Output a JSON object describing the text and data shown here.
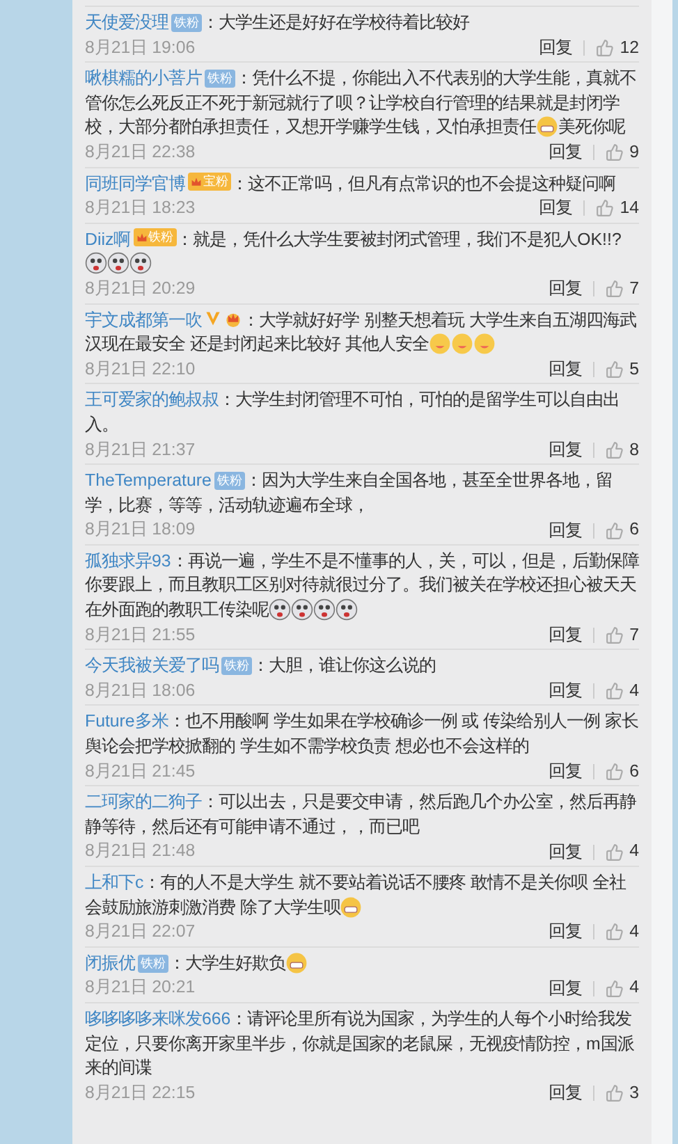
{
  "comments": [
    {
      "user": "天使爱没理",
      "badges": [
        {
          "kind": "fan",
          "text": "铁粉"
        }
      ],
      "content": [
        {
          "kind": "text",
          "text": "：大学生还是好好在学校待着比较好"
        }
      ],
      "time": "8月21日 19:06",
      "reply": "回复",
      "likes": "12"
    },
    {
      "user": "啾棋糯的小菩片",
      "badges": [
        {
          "kind": "fan",
          "text": "铁粉"
        }
      ],
      "content": [
        {
          "kind": "text",
          "text": "：凭什么不提，你能出入不代表别的大学生能，真就不管你怎么死反正不死于新冠就行了呗？让学校自行管理的结果就是封闭学校，大部分都怕承担责任，又想开学赚学生钱，又怕承担责任"
        },
        {
          "kind": "grin"
        },
        {
          "kind": "text",
          "text": "美死你呢"
        }
      ],
      "time": "8月21日 22:38",
      "reply": "回复",
      "likes": "9"
    },
    {
      "user": "同班同学官博",
      "badges": [
        {
          "kind": "gold",
          "text": "宝粉"
        }
      ],
      "content": [
        {
          "kind": "text",
          "text": "：这不正常吗，但凡有点常识的也不会提这种疑问啊"
        }
      ],
      "time": "8月21日 18:23",
      "reply": "回复",
      "likes": "14"
    },
    {
      "user": "Diiz啊",
      "badges": [
        {
          "kind": "gold",
          "text": "铁粉"
        }
      ],
      "content": [
        {
          "kind": "text",
          "text": "：就是，凭什么大学生要被封闭式管理，我们不是犯人OK!!?"
        },
        {
          "kind": "cry"
        },
        {
          "kind": "cry"
        },
        {
          "kind": "cry"
        }
      ],
      "time": "8月21日 20:29",
      "reply": "回复",
      "likes": "7"
    },
    {
      "user": "宇文成都第一吹",
      "badges": [
        {
          "kind": "vip"
        },
        {
          "kind": "crown"
        }
      ],
      "content": [
        {
          "kind": "text",
          "text": "：大学就好好学  别整天想着玩 大学生来自五湖四海武汉现在最安全  还是封闭起来比较好  其他人安全"
        },
        {
          "kind": "yum"
        },
        {
          "kind": "yum"
        },
        {
          "kind": "yum"
        }
      ],
      "time": "8月21日 22:10",
      "reply": "回复",
      "likes": "5"
    },
    {
      "user": "王可爱家的鲍叔叔",
      "content": [
        {
          "kind": "text",
          "text": "：大学生封闭管理不可怕，可怕的是留学生可以自由出入。"
        }
      ],
      "time": "8月21日 21:37",
      "reply": "回复",
      "likes": "8"
    },
    {
      "user": "TheTemperature",
      "badges": [
        {
          "kind": "fan",
          "text": "铁粉"
        }
      ],
      "content": [
        {
          "kind": "text",
          "text": "：因为大学生来自全国各地，甚至全世界各地，留学，比赛，等等，活动轨迹遍布全球，"
        }
      ],
      "time": "8月21日 18:09",
      "reply": "回复",
      "likes": "6"
    },
    {
      "user": "孤独求异93",
      "content": [
        {
          "kind": "text",
          "text": "：再说一遍，学生不是不懂事的人，关，可以，但是，后勤保障你要跟上，而且教职工区别对待就很过分了。我们被关在学校还担心被天天在外面跑的教职工传染呢"
        },
        {
          "kind": "cry"
        },
        {
          "kind": "cry"
        },
        {
          "kind": "cry"
        },
        {
          "kind": "cry"
        }
      ],
      "time": "8月21日 21:55",
      "reply": "回复",
      "likes": "7"
    },
    {
      "user": "今天我被关爱了吗",
      "badges": [
        {
          "kind": "fan",
          "text": "铁粉"
        }
      ],
      "content": [
        {
          "kind": "text",
          "text": "：大胆，谁让你这么说的"
        }
      ],
      "time": "8月21日 18:06",
      "reply": "回复",
      "likes": "4"
    },
    {
      "user": "Future多米",
      "content": [
        {
          "kind": "text",
          "text": "：也不用酸啊 学生如果在学校确诊一例 或 传染给别人一例 家长舆论会把学校掀翻的  学生如不需学校负责 想必也不会这样的"
        }
      ],
      "time": "8月21日 21:45",
      "reply": "回复",
      "likes": "6"
    },
    {
      "user": "二珂家的二狗子",
      "content": [
        {
          "kind": "text",
          "text": "：可以出去，只是要交申请，然后跑几个办公室，然后再静静等待，然后还有可能申请不通过，，而已吧"
        }
      ],
      "time": "8月21日 21:48",
      "reply": "回复",
      "likes": "4"
    },
    {
      "user": "上和下c",
      "content": [
        {
          "kind": "text",
          "text": "：有的人不是大学生 就不要站着说话不腰疼 敢情不是关你呗 全社会鼓励旅游刺激消费 除了大学生呗"
        },
        {
          "kind": "grin"
        }
      ],
      "time": "8月21日 22:07",
      "reply": "回复",
      "likes": "4"
    },
    {
      "user": "闭振优",
      "badges": [
        {
          "kind": "fan",
          "text": "铁粉"
        }
      ],
      "content": [
        {
          "kind": "text",
          "text": "：大学生好欺负"
        },
        {
          "kind": "grin"
        }
      ],
      "time": "8月21日 20:21",
      "reply": "回复",
      "likes": "4"
    },
    {
      "user": "哆哆哆哆来咪发666",
      "content": [
        {
          "kind": "text",
          "text": "：请评论里所有说为国家，为学生的人每个小时给我发定位，只要你离开家里半步，你就是国家的老鼠屎，无视疫情防控，m国派来的间谍"
        }
      ],
      "time": "8月21日 22:15",
      "reply": "回复",
      "likes": "3"
    }
  ]
}
